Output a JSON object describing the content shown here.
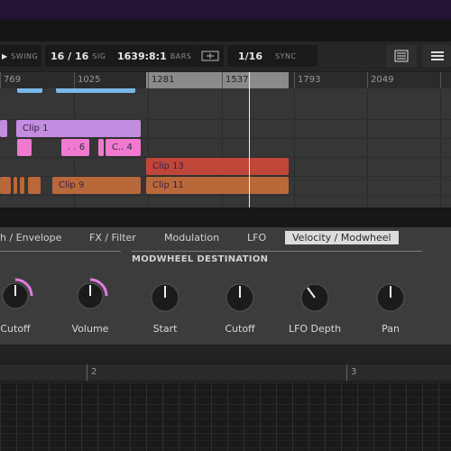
{
  "transport": {
    "swing_label": "SWING",
    "sig_value": "16 / 16",
    "sig_label": "SIG",
    "bars_value": "1639:8:1",
    "bars_label": "BARS",
    "sync_value": "1/16",
    "sync_label": "SYNC"
  },
  "ruler": {
    "marks": [
      "769",
      "1025",
      "1281",
      "1537",
      "1793",
      "2049"
    ]
  },
  "clips": {
    "clip1": "Clip 1",
    "clip6": ". . 6",
    "clipc4": "C.. 4",
    "clip13": "Clip 13",
    "clip9": "Clip 9",
    "clip11": "Clip 11"
  },
  "colors": {
    "lilac": "#c28ce0",
    "pink": "#f07ad0",
    "red": "#c0463a",
    "orange": "#b9683a",
    "blue": "#7ab8e6"
  },
  "panel": {
    "tabs": [
      "h / Envelope",
      "FX / Filter",
      "Modulation",
      "LFO",
      "Velocity / Modwheel"
    ],
    "selected_tab": "Velocity / Modwheel",
    "section_title": "MODWHEEL DESTINATION",
    "knobs": [
      "Cutoff",
      "Volume",
      "Start",
      "Cutoff",
      "LFO Depth",
      "Pan"
    ]
  },
  "pattern": {
    "markers": [
      "2",
      "3"
    ]
  }
}
